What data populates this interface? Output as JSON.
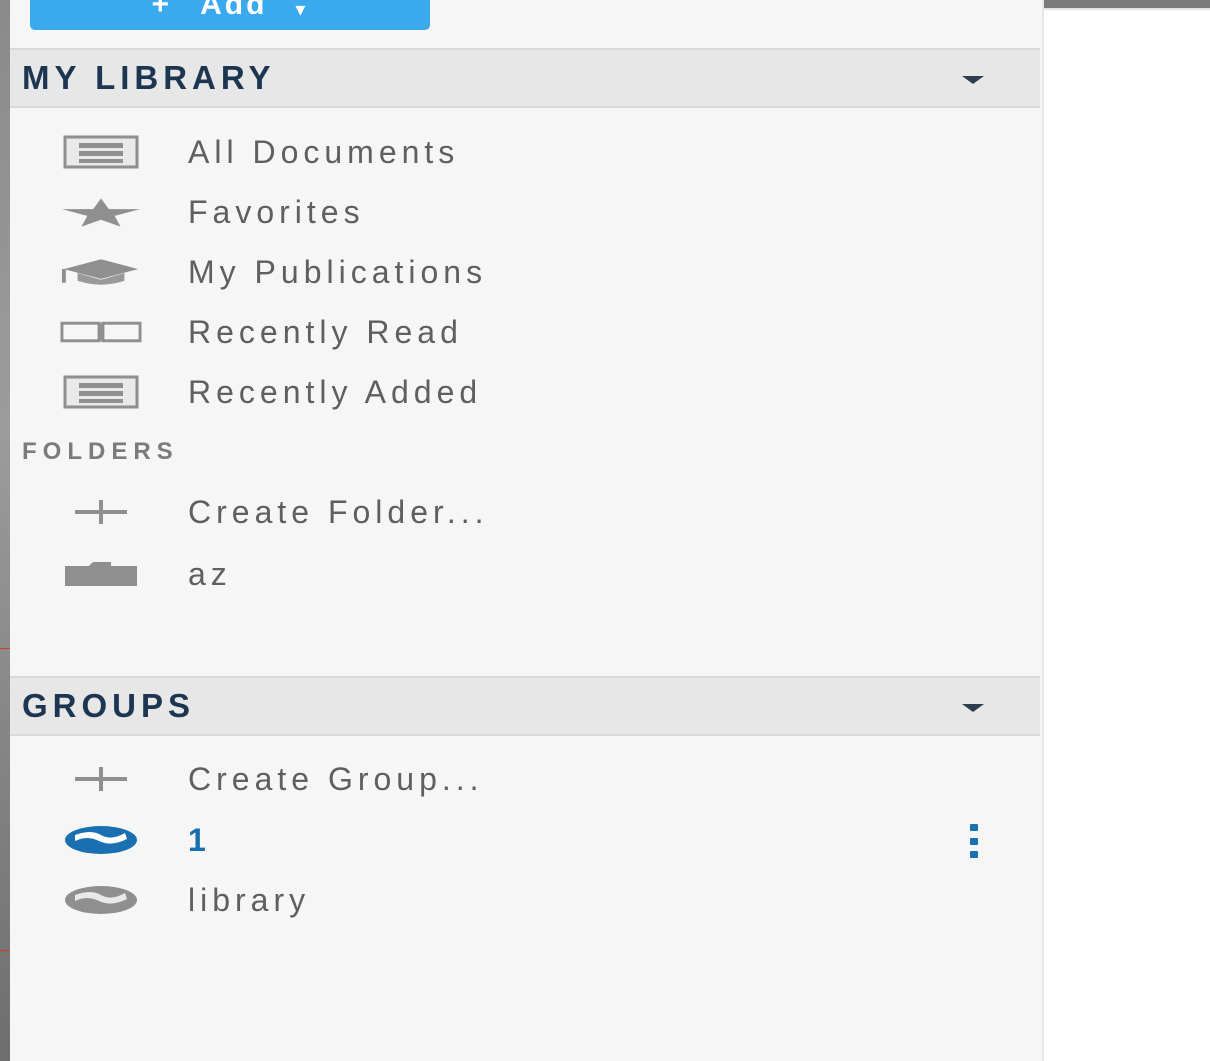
{
  "toolbar": {
    "add_label": "Add"
  },
  "my_library": {
    "title": "MY LIBRARY",
    "items": [
      {
        "label": "All Documents",
        "icon": "document-list-icon"
      },
      {
        "label": "Favorites",
        "icon": "star-icon"
      },
      {
        "label": "My Publications",
        "icon": "graduation-cap-icon"
      },
      {
        "label": "Recently Read",
        "icon": "open-book-icon"
      },
      {
        "label": "Recently Added",
        "icon": "document-list-icon"
      }
    ]
  },
  "folders": {
    "title": "FOLDERS",
    "items": [
      {
        "label": "Create Folder...",
        "icon": "plus-icon"
      },
      {
        "label": "az",
        "icon": "folder-icon"
      }
    ]
  },
  "groups": {
    "title": "GROUPS",
    "items": [
      {
        "label": "Create Group...",
        "icon": "plus-icon"
      },
      {
        "label": "1",
        "icon": "globe-icon"
      },
      {
        "label": "library",
        "icon": "globe-icon"
      }
    ]
  },
  "colors": {
    "accent": "#3aa9ee",
    "header_text": "#1c3550",
    "sidebar_bg": "#f6f6f6",
    "header_bg": "#e7e7e7",
    "kebab": "#1a6fb0"
  }
}
